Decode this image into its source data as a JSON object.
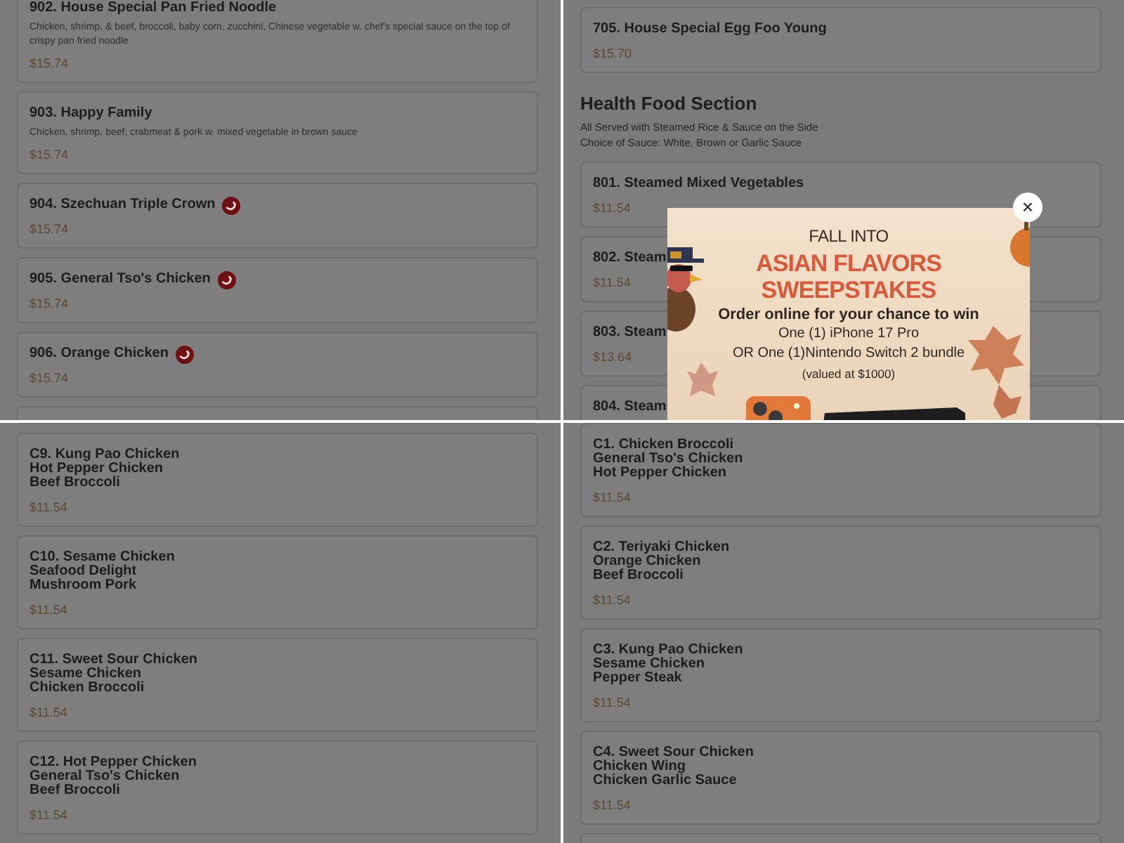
{
  "panels": [
    {
      "blocks": [
        {
          "kind": "card",
          "title_lines": [
            "902. House Special Pan Fried Noodle"
          ],
          "description": "Chicken, shrimp, & beef, broccoli, baby corn, zucchini, Chinese vegetable w. chef's special sauce on the top of crispy pan fried noodle",
          "price": "$15.74",
          "spicy": false
        },
        {
          "kind": "card",
          "title_lines": [
            "903. Happy Family"
          ],
          "description": "Chicken, shrimp, beef, crabmeat & pork w. mixed vegetable in brown sauce",
          "price": "$15.74",
          "spicy": false
        },
        {
          "kind": "card",
          "title_lines": [
            "904. Szechuan Triple Crown"
          ],
          "price": "$15.74",
          "spicy": true
        },
        {
          "kind": "card",
          "title_lines": [
            "905. General Tso's Chicken"
          ],
          "price": "$15.74",
          "spicy": true
        },
        {
          "kind": "card",
          "title_lines": [
            "906. Orange Chicken"
          ],
          "price": "$15.74",
          "spicy": true
        },
        {
          "kind": "stub"
        }
      ]
    },
    {
      "blocks": [
        {
          "kind": "stub"
        },
        {
          "kind": "card",
          "title_lines": [
            "705. House Special Egg Foo Young"
          ],
          "price": "$15.70",
          "spicy": false
        },
        {
          "kind": "section",
          "title": "Health Food Section",
          "notes": [
            "All Served with Steamed Rice & Sauce on the Side",
            "Choice of Sauce: White, Brown or Garlic Sauce"
          ]
        },
        {
          "kind": "card",
          "title_lines": [
            "801. Steamed Mixed Vegetables"
          ],
          "price": "$11.54",
          "spicy": false
        },
        {
          "kind": "card",
          "title_lines": [
            "802. Steam"
          ],
          "price": "$11.54",
          "spicy": false
        },
        {
          "kind": "card",
          "title_lines": [
            "803. Steam"
          ],
          "price": "$13.64",
          "spicy": false
        },
        {
          "kind": "card",
          "title_lines": [
            "804. Steam"
          ],
          "spicy": false
        }
      ],
      "popup": {
        "kicker": "FALL INTO",
        "headline_lines": [
          "ASIAN FLAVORS",
          "SWEEPSTAKES"
        ],
        "lead": "Order online for your chance to win",
        "prize_lines": [
          "One (1) iPhone 17 Pro",
          "OR One (1)Nintendo Switch 2 bundle"
        ],
        "note": "(valued at $1000)",
        "close": "×"
      }
    },
    {
      "blocks": [
        {
          "kind": "stub"
        },
        {
          "kind": "card",
          "title_lines": [
            "C9. Kung Pao Chicken",
            "Hot Pepper Chicken",
            "Beef Broccoli"
          ],
          "price": "$11.54",
          "spicy": false
        },
        {
          "kind": "card",
          "title_lines": [
            "C10. Sesame Chicken",
            "Seafood Delight",
            "Mushroom Pork"
          ],
          "price": "$11.54",
          "spicy": false
        },
        {
          "kind": "card",
          "title_lines": [
            "C11. Sweet Sour Chicken",
            "Sesame Chicken",
            "Chicken Broccoli"
          ],
          "price": "$11.54",
          "spicy": false
        },
        {
          "kind": "card",
          "title_lines": [
            "C12. Hot Pepper Chicken",
            "General Tso's Chicken",
            "Beef Broccoli"
          ],
          "price": "$11.54",
          "spicy": false
        }
      ]
    },
    {
      "blocks": [
        {
          "kind": "card",
          "title_lines": [
            "C1. Chicken Broccoli",
            "General Tso's Chicken",
            "Hot Pepper Chicken"
          ],
          "price": "$11.54",
          "spicy": false
        },
        {
          "kind": "card",
          "title_lines": [
            "C2. Teriyaki Chicken",
            "Orange Chicken",
            "Beef Broccoli"
          ],
          "price": "$11.54",
          "spicy": false
        },
        {
          "kind": "card",
          "title_lines": [
            "C3. Kung Pao Chicken",
            "Sesame Chicken",
            "Pepper Steak"
          ],
          "price": "$11.54",
          "spicy": false
        },
        {
          "kind": "card",
          "title_lines": [
            "C4. Sweet Sour Chicken",
            "Chicken Wing",
            "Chicken Garlic Sauce"
          ],
          "price": "$11.54",
          "spicy": false
        },
        {
          "kind": "stub"
        }
      ]
    }
  ]
}
